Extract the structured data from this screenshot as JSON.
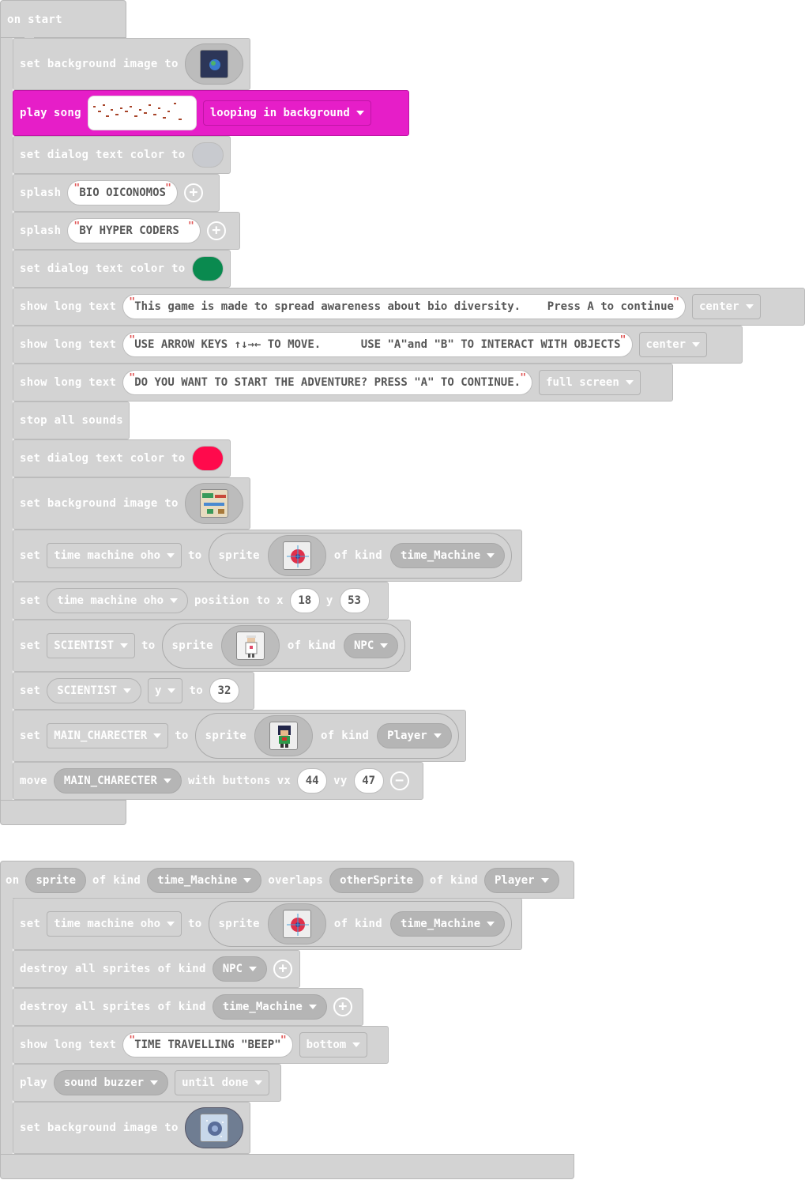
{
  "on_start": {
    "hat_label": "on start",
    "b1": {
      "label": "set background image to",
      "icon": "earth-image-icon"
    },
    "b2": {
      "play": "play",
      "song": "song",
      "mode": "looping in background"
    },
    "b3": {
      "label": "set dialog text color to",
      "color": "#c8cacf"
    },
    "b4": {
      "label": "splash",
      "text": "BIO OICONOMOS"
    },
    "b5": {
      "label": "splash",
      "text": "BY HYPER CODERS"
    },
    "b6": {
      "label": "set dialog text color to",
      "color": "#0a8a4f"
    },
    "b7": {
      "label": "show long text",
      "text": "This game is made to spread awareness about bio diversity.    Press A to continue",
      "align": "center"
    },
    "b8": {
      "label": "show long text",
      "text": "USE ARROW KEYS ↑↓→← TO MOVE.      USE \"A\"and \"B\" TO INTERACT WITH OBJECTS",
      "align": "center"
    },
    "b9": {
      "label": "show long text",
      "text": "DO YOU WANT TO START THE ADVENTURE? PRESS \"A\" TO CONTINUE.",
      "align": "full screen"
    },
    "b10": {
      "label": "stop all sounds"
    },
    "b11": {
      "label": "set dialog text color to",
      "color": "#ff0a4c"
    },
    "b12": {
      "label": "set background image to",
      "icon": "map-image-icon"
    },
    "b13": {
      "set": "set",
      "var": "time machine oho",
      "to": "to",
      "sprite": "sprite",
      "of_kind": "of kind",
      "kind": "time_Machine"
    },
    "b14": {
      "set": "set",
      "var": "time machine oho",
      "position_to": "position to",
      "x_lbl": "x",
      "x": "18",
      "y_lbl": "y",
      "y": "53"
    },
    "b15": {
      "set": "set",
      "var": "SCIENTIST",
      "to": "to",
      "sprite": "sprite",
      "of_kind": "of kind",
      "kind": "NPC"
    },
    "b16": {
      "set": "set",
      "var": "SCIENTIST",
      "prop": "y",
      "to": "to",
      "value": "32"
    },
    "b17": {
      "set": "set",
      "var": "MAIN_CHARECTER",
      "to": "to",
      "sprite": "sprite",
      "of_kind": "of kind",
      "kind": "Player"
    },
    "b18": {
      "move": "move",
      "var": "MAIN_CHARECTER",
      "with_buttons": "with buttons",
      "vx_lbl": "vx",
      "vx": "44",
      "vy_lbl": "vy",
      "vy": "47"
    }
  },
  "on_overlap": {
    "hat": {
      "on": "on",
      "sprite": "sprite",
      "of_kind": "of kind",
      "kind1": "time_Machine",
      "overlaps": "overlaps",
      "other": "otherSprite",
      "of_kind2": "of kind",
      "kind2": "Player"
    },
    "b1": {
      "set": "set",
      "var": "time machine oho",
      "to": "to",
      "sprite": "sprite",
      "of_kind": "of kind",
      "kind": "time_Machine"
    },
    "b2": {
      "label": "destroy all sprites of kind",
      "kind": "NPC"
    },
    "b3": {
      "label": "destroy all sprites of kind",
      "kind": "time_Machine"
    },
    "b4": {
      "label": "show long text",
      "text": "TIME TRAVELLING \"BEEP\"",
      "pos": "bottom"
    },
    "b5": {
      "play": "play",
      "sound": "sound buzzer",
      "until": "until done"
    },
    "b6": {
      "label": "set background image to",
      "icon": "galaxy-image-icon"
    }
  }
}
